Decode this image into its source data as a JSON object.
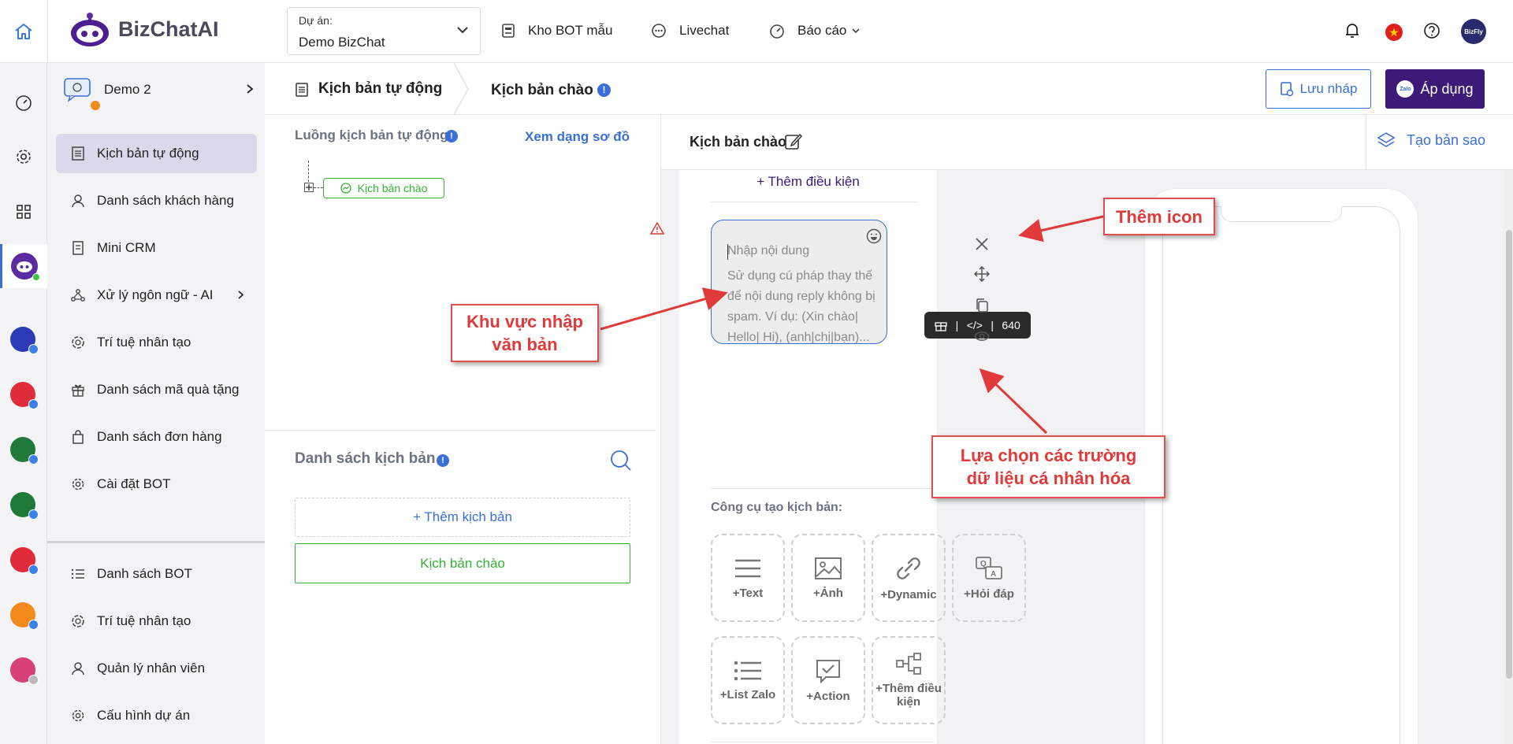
{
  "brand": {
    "name": "BizChatAI"
  },
  "project": {
    "label": "Dự án:",
    "value": "Demo BizChat"
  },
  "topnav": [
    {
      "label": "Kho BOT mẫu"
    },
    {
      "label": "Livechat"
    },
    {
      "label": "Báo cáo"
    }
  ],
  "avatar_text": "BizFly",
  "bot": {
    "name": "Demo 2"
  },
  "sidebar_items": [
    "Kịch bản tự động",
    "Danh sách khách hàng",
    "Mini CRM",
    "Xử lý ngôn ngữ - AI",
    "Trí tuệ nhân tạo",
    "Danh sách mã quà tặng",
    "Danh sách đơn hàng",
    "Cài đặt BOT"
  ],
  "sidebar_bottom": [
    "Danh sách BOT",
    "Trí tuệ nhân tạo",
    "Quản lý nhân viên",
    "Cấu hình dự án"
  ],
  "breadcrumb": {
    "first": "Kịch bản tự động",
    "second": "Kịch bản chào"
  },
  "actions": {
    "draft": "Lưu nháp",
    "apply": "Áp dụng",
    "zalo": "Zalo"
  },
  "flow": {
    "title": "Luồng kịch bản tự động",
    "diagram_link": "Xem dạng sơ đồ",
    "node": "Kịch bản chào"
  },
  "scripts": {
    "title": "Danh sách kịch bản",
    "add": "+ Thêm kịch bản",
    "item": "Kịch bản chào"
  },
  "editor": {
    "title": "Kịch bản chào",
    "copy": "Tạo bản sao",
    "add_condition": "+ Thêm điều kiện",
    "placeholder_line1": "Nhập nội dung",
    "placeholder_line2": "Sử dụng cú pháp thay thế để nội dung reply không bị spam. Ví dụ: (Xin chào| Hello| Hi), (anh|chị|bạn)...",
    "code_tag": "</>",
    "char_count": "640",
    "tools_title": "Công cụ tạo kịch bản:",
    "tools": [
      "+Text",
      "+Ảnh",
      "+Dynamic",
      "+Hỏi đáp",
      "+List Zalo",
      "+Action",
      "+Thêm điều kiện"
    ]
  },
  "callouts": {
    "icon": "Thêm icon",
    "text_area": "Khu vực nhập văn bản",
    "fields": "Lựa chọn các trường dữ liệu cá nhân hóa"
  },
  "colors": {
    "brand": "#3d1a78",
    "link": "#3b6fd8",
    "green": "#33b233",
    "annotation": "#e03a3a"
  }
}
